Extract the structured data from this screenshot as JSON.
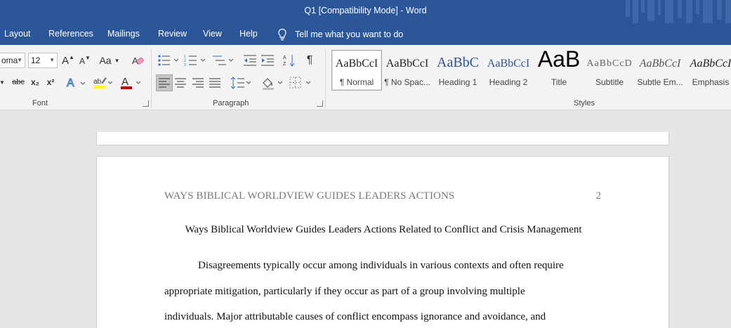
{
  "window": {
    "title": "Q1 [Compatibility Mode]  -  Word"
  },
  "tabs": [
    "Layout",
    "References",
    "Mailings",
    "Review",
    "View",
    "Help"
  ],
  "tell_me": "Tell me what you want to do",
  "font": {
    "name": "oma",
    "size": "12",
    "grow_label": "A",
    "shrink_label": "A",
    "case_label": "Aa",
    "strike_label": "abc",
    "sub_label": "x₂",
    "super_label": "x²",
    "effects_label": "A",
    "color_label": "A",
    "group_label": "Font"
  },
  "paragraph": {
    "group_label": "Paragraph",
    "pilcrow": "¶"
  },
  "styles": {
    "group_label": "Styles",
    "items": [
      {
        "sample": "AaBbCcI",
        "name": "¶ Normal"
      },
      {
        "sample": "AaBbCcI",
        "name": "¶ No Spac..."
      },
      {
        "sample": "AaBbC",
        "name": "Heading 1"
      },
      {
        "sample": "AaBbCcI",
        "name": "Heading 2"
      },
      {
        "sample": "AaB",
        "name": "Title"
      },
      {
        "sample": "AaBbCcD",
        "name": "Subtitle"
      },
      {
        "sample": "AaBbCcI",
        "name": "Subtle Em..."
      },
      {
        "sample": "AaBbCcI",
        "name": "Emphasis"
      }
    ]
  },
  "colors": {
    "titlebar": "#2b579a",
    "highlight": "#ffff00",
    "font_color": "#c00000",
    "heading_blue": "#2f5496"
  },
  "document": {
    "running_head": "WAYS BIBLICAL WORLDVIEW GUIDES LEADERS ACTIONS",
    "page_number": "2",
    "title": "Ways Biblical Worldview Guides Leaders Actions Related to Conflict and Crisis Management",
    "lines": [
      "Disagreements typically occur among individuals in various contexts and often require",
      "appropriate mitigation, particularly if they occur as part of a group involving multiple",
      "individuals. Major attributable causes of conflict encompass ignorance and avoidance, and"
    ]
  }
}
